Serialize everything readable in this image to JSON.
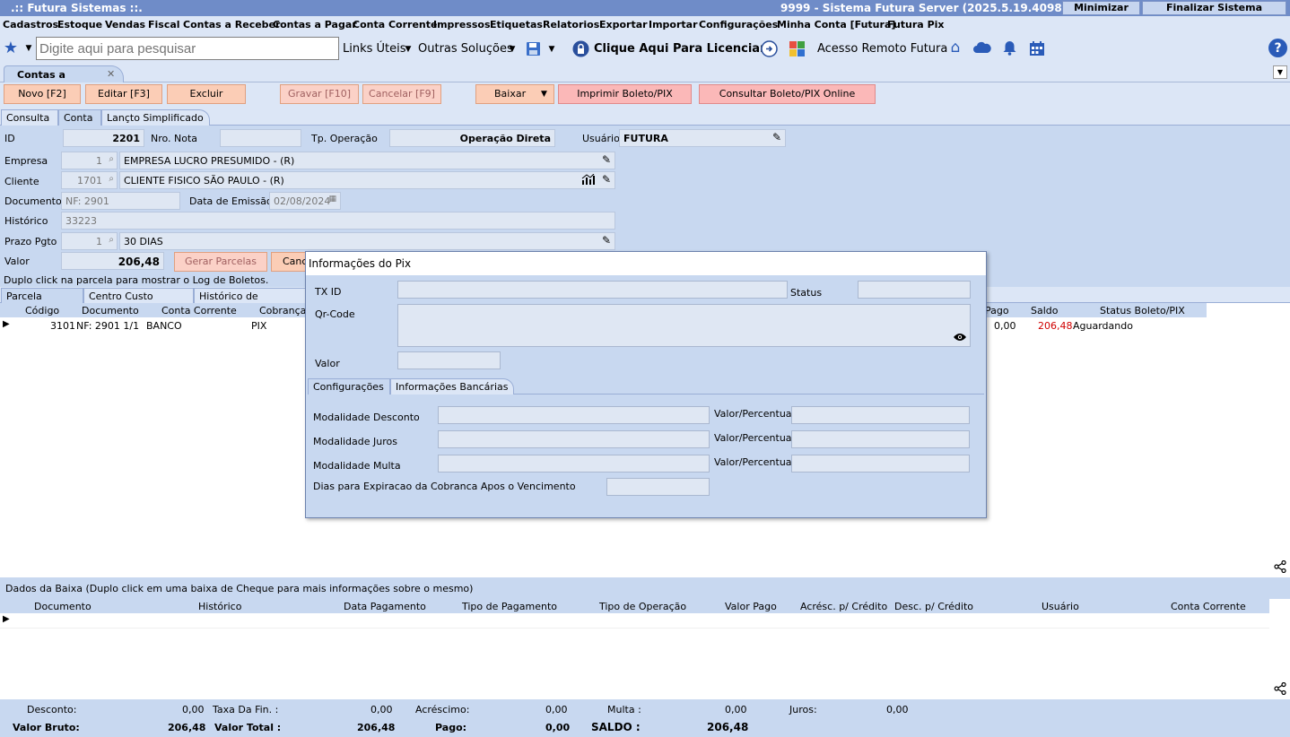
{
  "window": {
    "title_left": ".:: Futura Sistemas ::.",
    "title_right": "9999 - Sistema Futura Server (2025.5.19.4098)",
    "minimize": "Minimizar",
    "close": "Finalizar Sistema"
  },
  "menu": [
    "Cadastros",
    "Estoque",
    "Vendas",
    "Fiscal",
    "Contas a Receber",
    "Contas a Pagar",
    "Conta Corrente",
    "Impressos",
    "Etiquetas",
    "Relatorios",
    "Exportar",
    "Importar",
    "Configurações",
    "Minha Conta [Futura]",
    "Futura Pix"
  ],
  "toolbar": {
    "search_placeholder": "Digite aqui para pesquisar",
    "links": "Links Úteis",
    "outras": "Outras Soluções",
    "licenciar": "Clique Aqui Para Licenciar!",
    "remoto": "Acesso Remoto Futura"
  },
  "doc_tab": {
    "label": "Contas a Receber",
    "close": "✕"
  },
  "actions": {
    "novo": "Novo [F2]",
    "editar": "Editar [F3]",
    "excluir": "Excluir",
    "gravar": "Gravar [F10]",
    "cancelar": "Cancelar [F9]",
    "baixar": "Baixar",
    "imprimir": "Imprimir Boleto/PIX",
    "consultar": "Consultar Boleto/PIX Online"
  },
  "form_tabs": [
    "Consulta",
    "Conta",
    "Lançto Simplificado"
  ],
  "form": {
    "id_label": "ID",
    "id": "2201",
    "nro_nota_label": "Nro. Nota",
    "nro_nota": "",
    "tp_op_label": "Tp. Operação",
    "tp_op": "Operação Direta",
    "usuario_label": "Usuário",
    "usuario": "FUTURA",
    "empresa_label": "Empresa",
    "empresa_cod": "1",
    "empresa": "EMPRESA LUCRO PRESUMIDO - (R)",
    "cliente_label": "Cliente",
    "cliente_cod": "1701",
    "cliente": "CLIENTE FISICO SÃO PAULO - (R)",
    "documento_label": "Documento",
    "documento": "NF: 2901",
    "data_emissao_label": "Data de Emissão",
    "data_emissao": "02/08/2024",
    "historico_label": "Histórico",
    "historico": "33223",
    "prazo_label": "Prazo Pgto",
    "prazo_cod": "1",
    "prazo": "30 DIAS",
    "valor_label": "Valor",
    "valor": "206,48",
    "gerar_parcelas": "Gerar Parcelas",
    "cancelar_parcelas": "Canc",
    "hint": "Duplo click na parcela para mostrar o Log de Boletos."
  },
  "sub_tabs": [
    "Parcela (Alt+P)",
    "Centro Custo (Alt+C)",
    "Histórico de renegociaç"
  ],
  "parcelas": {
    "headers": [
      "Código",
      "Documento",
      "Conta Corrente",
      "Cobrança",
      "Pago",
      "Saldo",
      "Status Boleto/PIX"
    ],
    "rows": [
      {
        "codigo": "3101",
        "documento": "NF: 2901 1/1",
        "conta": "BANCO",
        "cobranca": "PIX",
        "pago": "0,00",
        "saldo": "206,48",
        "status": "Aguardando"
      }
    ]
  },
  "pix_dialog": {
    "title": "Informações do Pix",
    "txid_label": "TX ID",
    "status_label": "Status",
    "qrcode_label": "Qr-Code",
    "valor_label": "Valor",
    "tabs": [
      "Configurações",
      "Informações Bancárias"
    ],
    "desconto_label": "Modalidade Desconto",
    "juros_label": "Modalidade Juros",
    "multa_label": "Modalidade Multa",
    "valor_perc_label": "Valor/Percentual",
    "dias_label": "Dias para Expiracao da Cobranca Apos o Vencimento"
  },
  "baixa": {
    "title": "Dados da Baixa (Duplo click em uma baixa de Cheque para mais informações sobre o mesmo)",
    "headers": [
      "Documento",
      "Histórico",
      "Data Pagamento",
      "Tipo de Pagamento",
      "Tipo de Operação",
      "Valor Pago",
      "Acrésc. p/ Crédito",
      "Desc. p/ Crédito",
      "Usuário",
      "Conta Corrente"
    ]
  },
  "totals": {
    "desconto_label": "Desconto:",
    "desconto": "0,00",
    "taxa_label": "Taxa Da Fin. :",
    "taxa": "0,00",
    "acrescimo_label": "Acréscimo:",
    "acrescimo": "0,00",
    "multa_label": "Multa :",
    "multa": "0,00",
    "juros_label": "Juros:",
    "juros": "0,00",
    "bruto_label": "Valor Bruto:",
    "bruto": "206,48",
    "total_label": "Valor Total :",
    "total": "206,48",
    "pago_label": "Pago:",
    "pago": "0,00",
    "saldo_label": "SALDO :",
    "saldo": "206,48"
  }
}
